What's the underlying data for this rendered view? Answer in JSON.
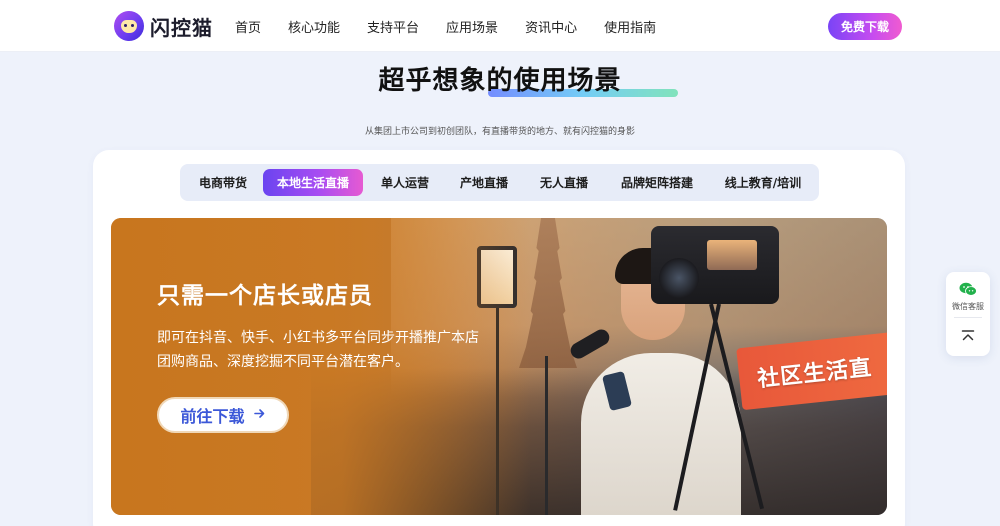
{
  "header": {
    "logo_text": "闪控猫",
    "nav": [
      "首页",
      "核心功能",
      "支持平台",
      "应用场景",
      "资讯中心",
      "使用指南"
    ],
    "download_label": "免费下载"
  },
  "section": {
    "title": "超乎想象的使用场景",
    "subtitle": "从集团上市公司到初创团队，有直播带货的地方、就有闪控猫的身影"
  },
  "tabs": {
    "items": [
      "电商带货",
      "本地生活直播",
      "单人运营",
      "产地直播",
      "无人直播",
      "品牌矩阵搭建",
      "线上教育/培训"
    ],
    "active": "本地生活直播"
  },
  "hero": {
    "title": "只需一个店长或店员",
    "desc_line1": "即可在抖音、快手、小红书多平台同步开播推广本店",
    "desc_line2": "团购商品、深度挖掘不同平台潜在客户。",
    "button_label": "前往下载",
    "banner_text": "社区生活直"
  },
  "side_widget": {
    "service_label": "微信客服"
  },
  "colors": {
    "brand_purple": "#7a44f6",
    "brand_pink": "#f05bd0",
    "hero_orange": "#c9771f",
    "button_text_blue": "#3c58d8"
  },
  "icons": [
    "logo-mark-icon",
    "wechat-icon",
    "back-to-top-icon",
    "arrow-right-icon"
  ]
}
